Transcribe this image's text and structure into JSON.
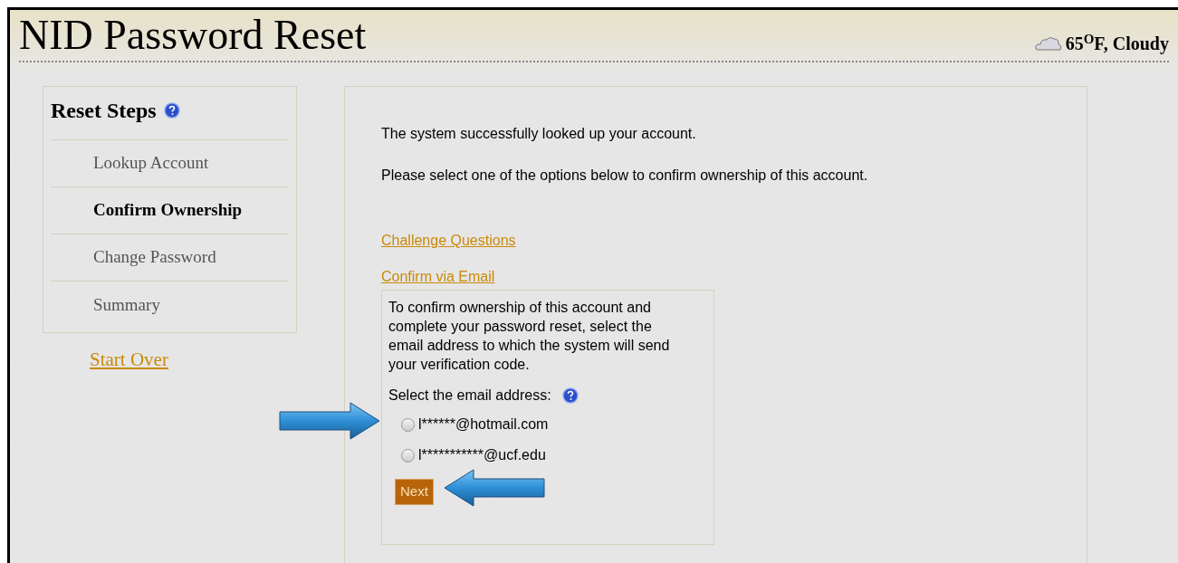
{
  "header": {
    "title": "NID Password Reset",
    "weather": "65$^{O}$F, Cloudy"
  },
  "sidebar": {
    "title": "Reset Steps",
    "steps": [
      {
        "label": "Lookup Account",
        "selected": false
      },
      {
        "label": "Confirm Ownership",
        "selected": true
      },
      {
        "label": "Change Password",
        "selected": false
      },
      {
        "label": "Summary",
        "selected": false
      }
    ],
    "start_over": "Start Over"
  },
  "main": {
    "messages": [
      "The system successfully looked up your account.",
      "Please select one of the options below to confirm ownership of this account."
    ],
    "options": [
      {
        "label": "Challenge Questions"
      },
      {
        "label": "Confirm via Email",
        "email_box": {
          "instructions": "To confirm ownership of this account and complete your password reset, select the email address to which the system will send your verification code.",
          "select_label": "Select the email address:",
          "emails": [
            {
              "address": "l******@hotmail.com",
              "selected": false
            },
            {
              "address": "l***********@ucf.edu",
              "selected": false
            }
          ],
          "next_button": "Next"
        }
      }
    ]
  }
}
